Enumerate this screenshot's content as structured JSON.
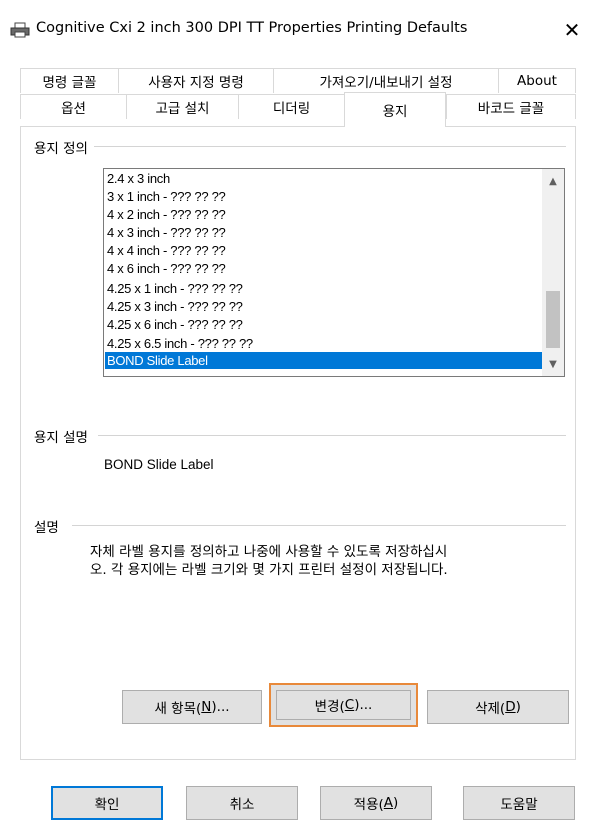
{
  "window": {
    "title": "Cognitive Cxi 2 inch 300 DPI TT Properties Printing Defaults",
    "close_symbol": "✕"
  },
  "tabs_row1": [
    {
      "label": "명령 글꼴"
    },
    {
      "label": "사용자 지정 명령"
    },
    {
      "label": "가져오기/내보내기 설정"
    },
    {
      "label": "About"
    }
  ],
  "tabs_row2": [
    {
      "label": "옵션"
    },
    {
      "label": "고급 설치"
    },
    {
      "label": "디더링"
    },
    {
      "label": "용지"
    },
    {
      "label": "바코드 글꼴"
    }
  ],
  "paper_definition": {
    "label": "용지 정의",
    "items": [
      "2.4 x 3 inch",
      "3 x 1 inch - ??? ?? ??",
      "4 x 2 inch - ??? ?? ??",
      "4 x 3 inch - ??? ?? ??",
      "4 x 4 inch - ??? ?? ??",
      "4 x 6 inch - ??? ?? ??",
      "4.25 x 1 inch - ??? ?? ??",
      "4.25 x 3 inch - ??? ?? ??",
      "4.25 x 6 inch - ??? ?? ??",
      "4.25 x 6.5 inch - ??? ?? ??",
      "BOND Slide Label"
    ],
    "selected": "BOND Slide Label"
  },
  "paper_description": {
    "label": "용지 설명",
    "value": "BOND Slide Label"
  },
  "description": {
    "label": "설명",
    "line1": "자체 라벨 용지를 정의하고 나중에 사용할 수 있도록 저장하십시",
    "line2": "오. 각 용지에는 라벨 크기와 몇 가지 프린터 설정이 저장됩니다."
  },
  "buttons": {
    "new": {
      "text": "새 항목(",
      "key": "N",
      "suffix": ")..."
    },
    "change": {
      "text": "변경(",
      "key": "C",
      "suffix": ")..."
    },
    "delete": {
      "text": "삭제(",
      "key": "D",
      "suffix": ")"
    }
  },
  "footer": {
    "ok": "확인",
    "cancel": "취소",
    "apply": {
      "text": "적용(",
      "key": "A",
      "suffix": ")"
    },
    "help": "도움말"
  },
  "colors": {
    "selection": "#0078d7",
    "focus_border": "#0078d7"
  }
}
